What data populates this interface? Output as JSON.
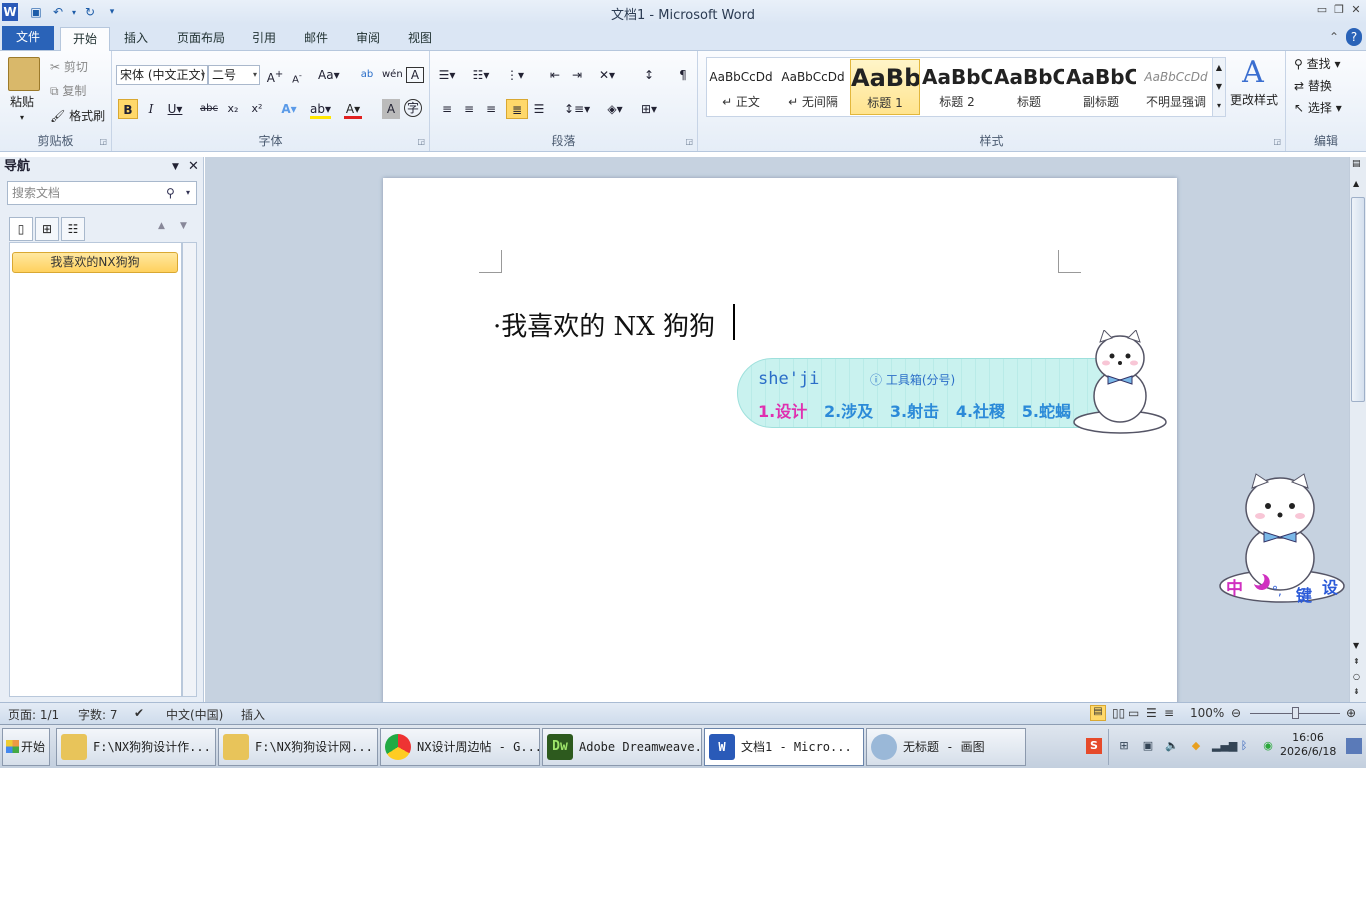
{
  "window": {
    "title": "文档1 - Microsoft Word"
  },
  "tabs": [
    "文件",
    "开始",
    "插入",
    "页面布局",
    "引用",
    "邮件",
    "审阅",
    "视图"
  ],
  "clipboard": {
    "paste": "粘贴",
    "cut": "剪切",
    "copy": "复制",
    "format_painter": "格式刷",
    "label": "剪贴板"
  },
  "font": {
    "name": "宋体 (中文正文)",
    "size": "二号",
    "label": "字体"
  },
  "paragraph": {
    "label": "段落"
  },
  "styles": {
    "label": "样式",
    "items": [
      {
        "preview": "AaBbCcDd",
        "name": "↵ 正文"
      },
      {
        "preview": "AaBbCcDd",
        "name": "↵ 无间隔"
      },
      {
        "preview": "AaBb",
        "name": "标题 1"
      },
      {
        "preview": "AaBbC",
        "name": "标题 2"
      },
      {
        "preview": "AaBbC",
        "name": "标题"
      },
      {
        "preview": "AaBbC",
        "name": "副标题"
      },
      {
        "preview": "AaBbCcDd",
        "name": "不明显强调"
      }
    ],
    "change": "更改样式"
  },
  "editing": {
    "find": "查找",
    "replace": "替换",
    "select": "选择",
    "label": "编辑"
  },
  "nav": {
    "title": "导航",
    "search_placeholder": "搜索文档",
    "heading_item": "我喜欢的NX狗狗"
  },
  "document": {
    "text": "我喜欢的 NX 狗狗"
  },
  "ime": {
    "composition": "she'ji",
    "toolbox": "工具箱(分号)",
    "candidates": [
      "1.设计",
      "2.涉及",
      "3.射击",
      "4.社稷",
      "5.蛇蝎"
    ],
    "status_text": "中",
    "status_key": "键",
    "status_set": "设"
  },
  "status": {
    "page": "页面: 1/1",
    "words": "字数: 7",
    "language": "中文(中国)",
    "mode": "插入",
    "zoom": "100%"
  },
  "taskbar": {
    "start": "开始",
    "items": [
      {
        "label": "F:\\NX狗狗设计作...",
        "color": "#e8c45a"
      },
      {
        "label": "F:\\NX狗狗设计网...",
        "color": "#e8c45a"
      },
      {
        "label": "NX设计周边帖 - G...",
        "color": "#3a8ee6"
      },
      {
        "label": "Adobe Dreamweave...",
        "color": "#3d7a2a"
      },
      {
        "label": "文档1 - Micro...",
        "color": "#2a5ab8"
      },
      {
        "label": "无标题 - 画图",
        "color": "#9ab8d8"
      }
    ],
    "time": "16:06",
    "date": "2026/6/18"
  }
}
